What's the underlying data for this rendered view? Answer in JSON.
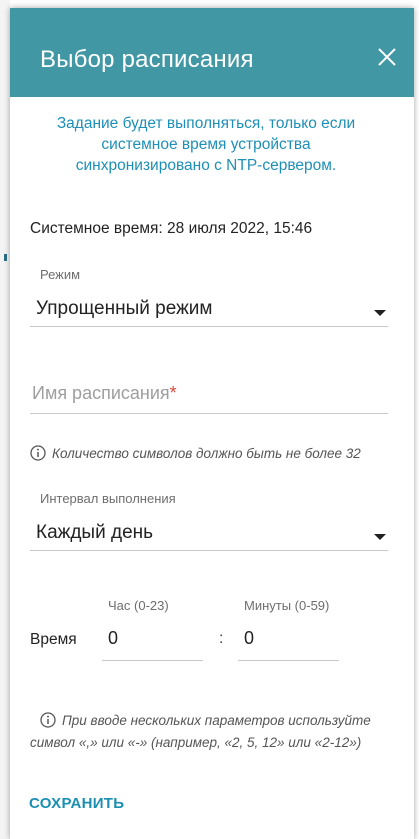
{
  "dialog": {
    "title": "Выбор расписания",
    "close_icon": "close-icon"
  },
  "notice": {
    "line1": "Задание будет выполняться, только если",
    "line2": "системное время устройства",
    "line3": "синхронизировано с NTP-сервером."
  },
  "system_time": "Системное время: 28 июля 2022, 15:46",
  "mode": {
    "label": "Режим",
    "value": "Упрощенный режим"
  },
  "schedule_name": {
    "placeholder": "Имя расписания",
    "required_mark": "*",
    "value": ""
  },
  "name_hint": "Количество символов должно быть не более 32",
  "interval": {
    "label": "Интервал выполнения",
    "value": "Каждый день"
  },
  "time": {
    "label": "Время",
    "hour_label": "Час (0-23)",
    "hour_value": "0",
    "separator": ":",
    "minutes_label": "Минуты (0-59)",
    "minutes_value": "0"
  },
  "params_hint": {
    "line1": "При вводе нескольких параметров используйте",
    "line2": "символ «,» или «-» (например, «2, 5, 12» или «2-12»)"
  },
  "save_label": "СОХРАНИТЬ",
  "colors": {
    "header": "#4297a4",
    "accent": "#1e8fb6",
    "required": "#d64a3c"
  }
}
